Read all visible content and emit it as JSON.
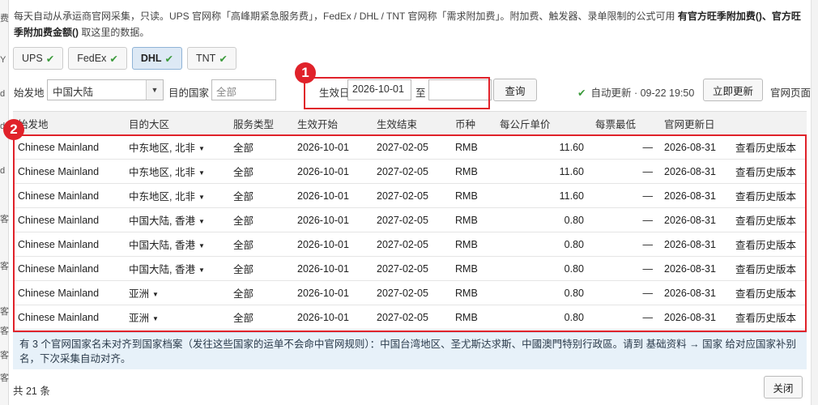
{
  "background_strip": [
    "费",
    "Y",
    "d",
    "d",
    "d",
    "客",
    "客",
    "客",
    "客",
    "客",
    "客"
  ],
  "info": {
    "line1": "每天自动从承运商官网采集，只读。UPS 官网称「高峰期紧急服务费」，FedEx / DHL / TNT 官网称「需求附加费」。附加费、触发器、录单限制的公式可用 ",
    "bold1": "有官方旺季附加费()、官方旺",
    "bold2": "季附加费金额()",
    "tail": " 取这里的数据。"
  },
  "tabs": [
    {
      "label": "UPS",
      "active": false
    },
    {
      "label": "FedEx",
      "active": false
    },
    {
      "label": "DHL",
      "active": true
    },
    {
      "label": "TNT",
      "active": false
    }
  ],
  "filters": {
    "origin_label": "始发地",
    "origin_value": "中国大陆",
    "dest_label": "目的国家",
    "dest_placeholder": "全部",
    "date_label": "生效日期",
    "date_from": "2026-10-01",
    "date_sep": "至",
    "date_to": "",
    "query_button": "查询",
    "auto_update": "自动更新 · 09-22 19:50",
    "update_now_button": "立即更新",
    "official_page": "官网页面"
  },
  "table": {
    "headers": [
      "始发地",
      "目的大区",
      "服务类型",
      "生效开始",
      "生效结束",
      "币种",
      "每公斤单价",
      "每票最低",
      "官网更新日",
      ""
    ],
    "rows": [
      {
        "origin": "Chinese Mainland",
        "region": "中东地区, 北非",
        "service": "全部",
        "start": "2026-10-01",
        "end": "2027-02-05",
        "currency": "RMB",
        "price": "11.60",
        "min": "—",
        "updated": "2026-08-31",
        "action": "查看历史版本"
      },
      {
        "origin": "Chinese Mainland",
        "region": "中东地区, 北非",
        "service": "全部",
        "start": "2026-10-01",
        "end": "2027-02-05",
        "currency": "RMB",
        "price": "11.60",
        "min": "—",
        "updated": "2026-08-31",
        "action": "查看历史版本"
      },
      {
        "origin": "Chinese Mainland",
        "region": "中东地区, 北非",
        "service": "全部",
        "start": "2026-10-01",
        "end": "2027-02-05",
        "currency": "RMB",
        "price": "11.60",
        "min": "—",
        "updated": "2026-08-31",
        "action": "查看历史版本"
      },
      {
        "origin": "Chinese Mainland",
        "region": "中国大陆, 香港",
        "service": "全部",
        "start": "2026-10-01",
        "end": "2027-02-05",
        "currency": "RMB",
        "price": "0.80",
        "min": "—",
        "updated": "2026-08-31",
        "action": "查看历史版本"
      },
      {
        "origin": "Chinese Mainland",
        "region": "中国大陆, 香港",
        "service": "全部",
        "start": "2026-10-01",
        "end": "2027-02-05",
        "currency": "RMB",
        "price": "0.80",
        "min": "—",
        "updated": "2026-08-31",
        "action": "查看历史版本"
      },
      {
        "origin": "Chinese Mainland",
        "region": "中国大陆, 香港",
        "service": "全部",
        "start": "2026-10-01",
        "end": "2027-02-05",
        "currency": "RMB",
        "price": "0.80",
        "min": "—",
        "updated": "2026-08-31",
        "action": "查看历史版本"
      },
      {
        "origin": "Chinese Mainland",
        "region": "亚洲",
        "service": "全部",
        "start": "2026-10-01",
        "end": "2027-02-05",
        "currency": "RMB",
        "price": "0.80",
        "min": "—",
        "updated": "2026-08-31",
        "action": "查看历史版本"
      },
      {
        "origin": "Chinese Mainland",
        "region": "亚洲",
        "service": "全部",
        "start": "2026-10-01",
        "end": "2027-02-05",
        "currency": "RMB",
        "price": "0.80",
        "min": "—",
        "updated": "2026-08-31",
        "action": "查看历史版本"
      }
    ]
  },
  "note": "有 3 个官网国家名未对齐到国家档案（发往这些国家的运单不会命中官网规则）：中国台湾地区、圣尤斯达求斯、中國澳門特别行政區。请到 基础资料 → 国家 给对应国家补别名，下次采集自动对齐。",
  "total": "共 21 条",
  "close_button": "关闭",
  "annotations": [
    {
      "number": "1",
      "color": "#e0222a"
    },
    {
      "number": "2",
      "color": "#e0222a"
    }
  ],
  "colors": {
    "accent": "#e0222a",
    "check": "#3a9a3a",
    "note_bg": "#e7f1f9"
  }
}
